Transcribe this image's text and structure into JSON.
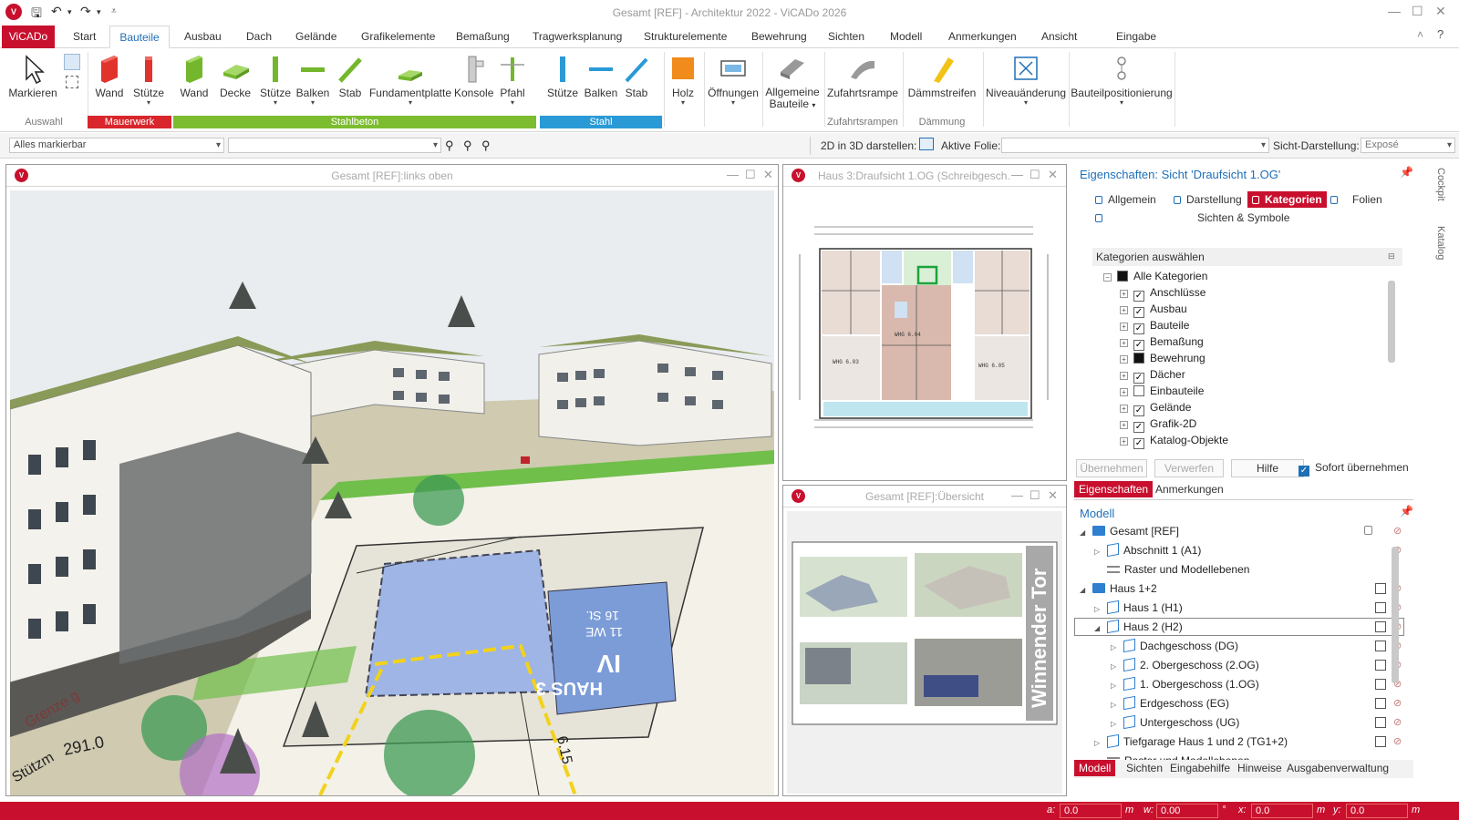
{
  "window": {
    "title": "Gesamt [REF] - Architektur 2022 - ViCADo 2026",
    "app_badge": "V"
  },
  "ribbon_tabs": [
    "ViCADo",
    "Start",
    "Bauteile",
    "Ausbau",
    "Dach",
    "Gelände",
    "Grafikelemente",
    "Bemaßung",
    "Tragwerksplanung",
    "Strukturelemente",
    "Bewehrung",
    "Sichten",
    "Modell",
    "Anmerkungen",
    "Ansicht",
    "Eingabe"
  ],
  "ribbon": {
    "buttons": {
      "markieren": "Markieren",
      "wand_mauer": "Wand",
      "stuetze_mauer": "Stütze",
      "wand_beton": "Wand",
      "decke": "Decke",
      "stuetze_beton": "Stütze",
      "balken_beton": "Balken",
      "stab_beton": "Stab",
      "fundamentplatte": "Fundamentplatte",
      "konsole": "Konsole",
      "pfahl": "Pfahl",
      "stuetze_stahl": "Stütze",
      "balken_stahl": "Balken",
      "stab_stahl": "Stab",
      "holz": "Holz",
      "oeffnungen": "Öffnungen",
      "allg_1": "Allgemeine",
      "allg_2": "Bauteile",
      "zufahrtsrampe": "Zufahrtsrampe",
      "daemmstreifen": "Dämmstreifen",
      "niveau": "Niveauänderung",
      "bauteilpos": "Bauteilpositionierung"
    },
    "groups": {
      "auswahl": "Auswahl",
      "mauerwerk": "Mauerwerk",
      "stahlbeton": "Stahlbeton",
      "stahl": "Stahl",
      "zufahrtsrampen": "Zufahrtsrampen",
      "daemmung": "Dämmung"
    },
    "group_colors": {
      "mauerwerk": "#d8262c",
      "stahlbeton": "#7cbd2f",
      "stahl": "#2a9ad6"
    }
  },
  "toolbar": {
    "select_filter": "Alles markierbar",
    "second_combo": "",
    "label_2d3d": "2D in 3D darstellen:",
    "label_folie": "Aktive Folie:",
    "folie_value": "",
    "label_sicht": "Sicht-Darstellung:",
    "sicht_value": "Exposé"
  },
  "views": {
    "v1": "Gesamt [REF]:links oben",
    "v2": "Haus 3:Draufsicht 1.OG (Schreibgesch...",
    "v3": "Gesamt [REF]:Übersicht"
  },
  "scene_labels": {
    "haus": "HAUS 3",
    "iv": "IV",
    "we": "11 WE",
    "st": "16 St.",
    "winnender": "Winnender Tor",
    "grenze": "Grenze g",
    "stuetzm": "Stützm",
    "num1": "291.0",
    "num2": "6.15",
    "whg1": "WHG 6.03",
    "whg2": "WHG 6.04",
    "whg3": "WHG 6.05"
  },
  "properties": {
    "title": "Eigenschaften: Sicht 'Draufsicht 1.OG'",
    "tabs": [
      "Allgemein",
      "Darstellung",
      "Kategorien",
      "Folien",
      "Sichten & Symbole"
    ],
    "section": "Kategorien auswählen",
    "root": "Alle Kategorien",
    "categories": [
      {
        "label": "Anschlüsse",
        "state": "checked"
      },
      {
        "label": "Ausbau",
        "state": "checked"
      },
      {
        "label": "Bauteile",
        "state": "checked"
      },
      {
        "label": "Bemaßung",
        "state": "checked"
      },
      {
        "label": "Bewehrung",
        "state": "partial"
      },
      {
        "label": "Dächer",
        "state": "checked"
      },
      {
        "label": "Einbauteile",
        "state": "unchecked"
      },
      {
        "label": "Gelände",
        "state": "checked"
      },
      {
        "label": "Grafik-2D",
        "state": "checked"
      },
      {
        "label": "Katalog-Objekte",
        "state": "checked"
      }
    ],
    "btn_apply": "Übernehmen",
    "btn_discard": "Verwerfen",
    "btn_help": "Hilfe",
    "auto_apply": "Sofort übernehmen",
    "lower_tabs": [
      "Eigenschaften",
      "Anmerkungen"
    ]
  },
  "model": {
    "title": "Modell",
    "items": [
      {
        "label": "Gesamt [REF]",
        "icon": "folder"
      },
      {
        "label": "Abschnitt 1 (A1)",
        "icon": "cube"
      },
      {
        "label": "Raster und Modellebenen",
        "icon": "layers"
      },
      {
        "label": "Haus 1+2",
        "icon": "folder"
      },
      {
        "label": "Haus 1 (H1)",
        "icon": "cube"
      },
      {
        "label": "Haus 2 (H2)",
        "icon": "cube"
      },
      {
        "label": "Dachgeschoss (DG)",
        "icon": "cube"
      },
      {
        "label": "2. Obergeschoss (2.OG)",
        "icon": "cube"
      },
      {
        "label": "1. Obergeschoss (1.OG)",
        "icon": "cube"
      },
      {
        "label": "Erdgeschoss (EG)",
        "icon": "cube"
      },
      {
        "label": "Untergeschoss (UG)",
        "icon": "cube"
      },
      {
        "label": "Tiefgarage Haus 1 und 2 (TG1+2)",
        "icon": "cube"
      },
      {
        "label": "Raster und Modellebenen",
        "icon": "layers"
      }
    ],
    "bottom_tabs": [
      "Modell",
      "Sichten",
      "Eingabehilfe",
      "Hinweise",
      "Ausgabenverwaltung"
    ]
  },
  "side_tabs": [
    "Cockpit",
    "Katalog"
  ],
  "status": {
    "a_label": "a:",
    "a_val": "0.0",
    "a_unit": "m",
    "w_label": "w:",
    "w_val": "0.00",
    "w_unit": "°",
    "x_label": "x:",
    "x_val": "0.0",
    "x_unit": "m",
    "y_label": "y:",
    "y_val": "0.0",
    "y_unit": "m"
  }
}
